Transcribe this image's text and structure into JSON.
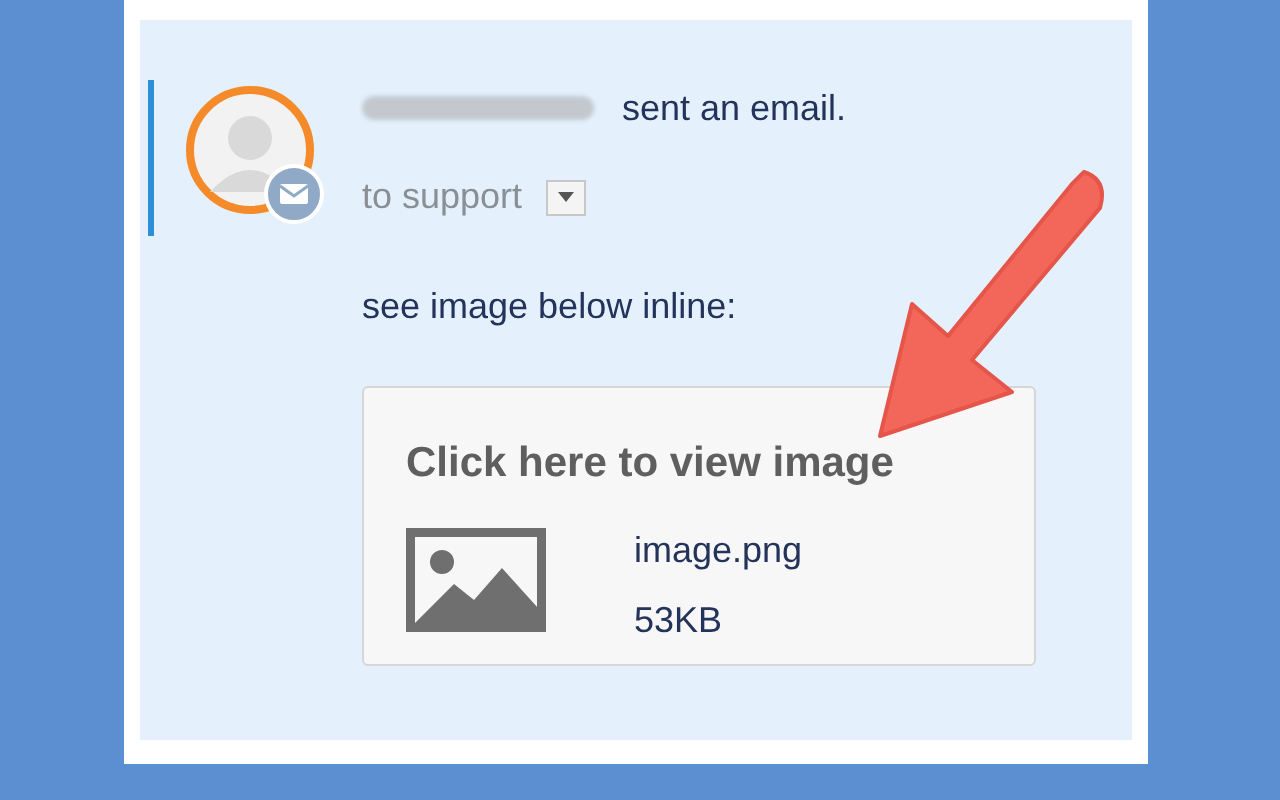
{
  "message": {
    "action": "sent an email.",
    "recipient": "to support",
    "body": "see image below inline:"
  },
  "attachment": {
    "title": "Click here to view image",
    "filename": "image.png",
    "size": "53KB"
  }
}
